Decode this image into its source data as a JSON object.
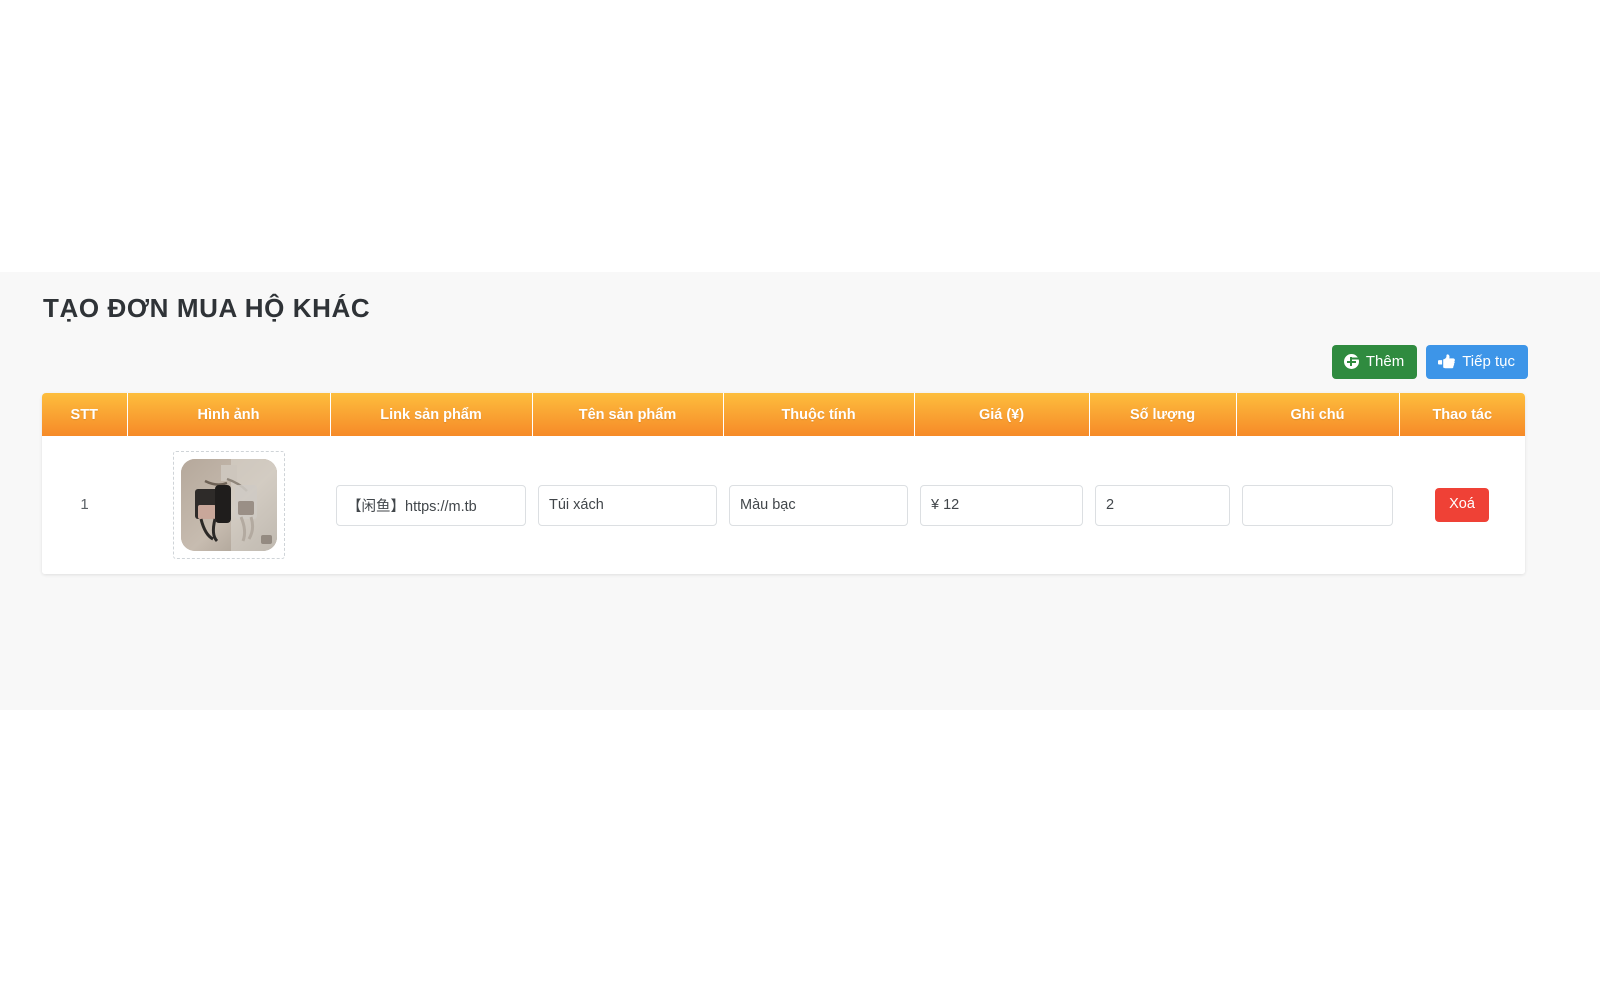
{
  "page": {
    "title": "TẠO ĐƠN MUA HỘ KHÁC",
    "background_color": "#f8f8f8",
    "accent_color": "#f79420"
  },
  "toolbar": {
    "add_label": "Thêm",
    "add_icon": "plus-circle-icon",
    "add_color": "#2f8b3f",
    "continue_label": "Tiếp tục",
    "continue_icon": "hand-point-right-icon",
    "continue_color": "#3d95e8"
  },
  "table": {
    "headers": [
      "STT",
      "Hình ảnh",
      "Link sản phẩm",
      "Tên sản phẩm",
      "Thuộc tính",
      "Giá (¥)",
      "Số lượng",
      "Ghi chú",
      "Thao tác"
    ],
    "rows": [
      {
        "stt": "1",
        "image_alt": "product-thumbnail",
        "link": "【闲鱼】https://m.tb",
        "link_placeholder": "",
        "name": "Túi xách",
        "name_placeholder": "",
        "attribute": "Màu bạc",
        "attribute_placeholder": "",
        "price": "¥ 12",
        "price_placeholder": "",
        "quantity": "2",
        "quantity_placeholder": "",
        "note": "",
        "note_placeholder": "",
        "delete_label": "Xoá",
        "delete_color": "#ef4136"
      }
    ]
  }
}
